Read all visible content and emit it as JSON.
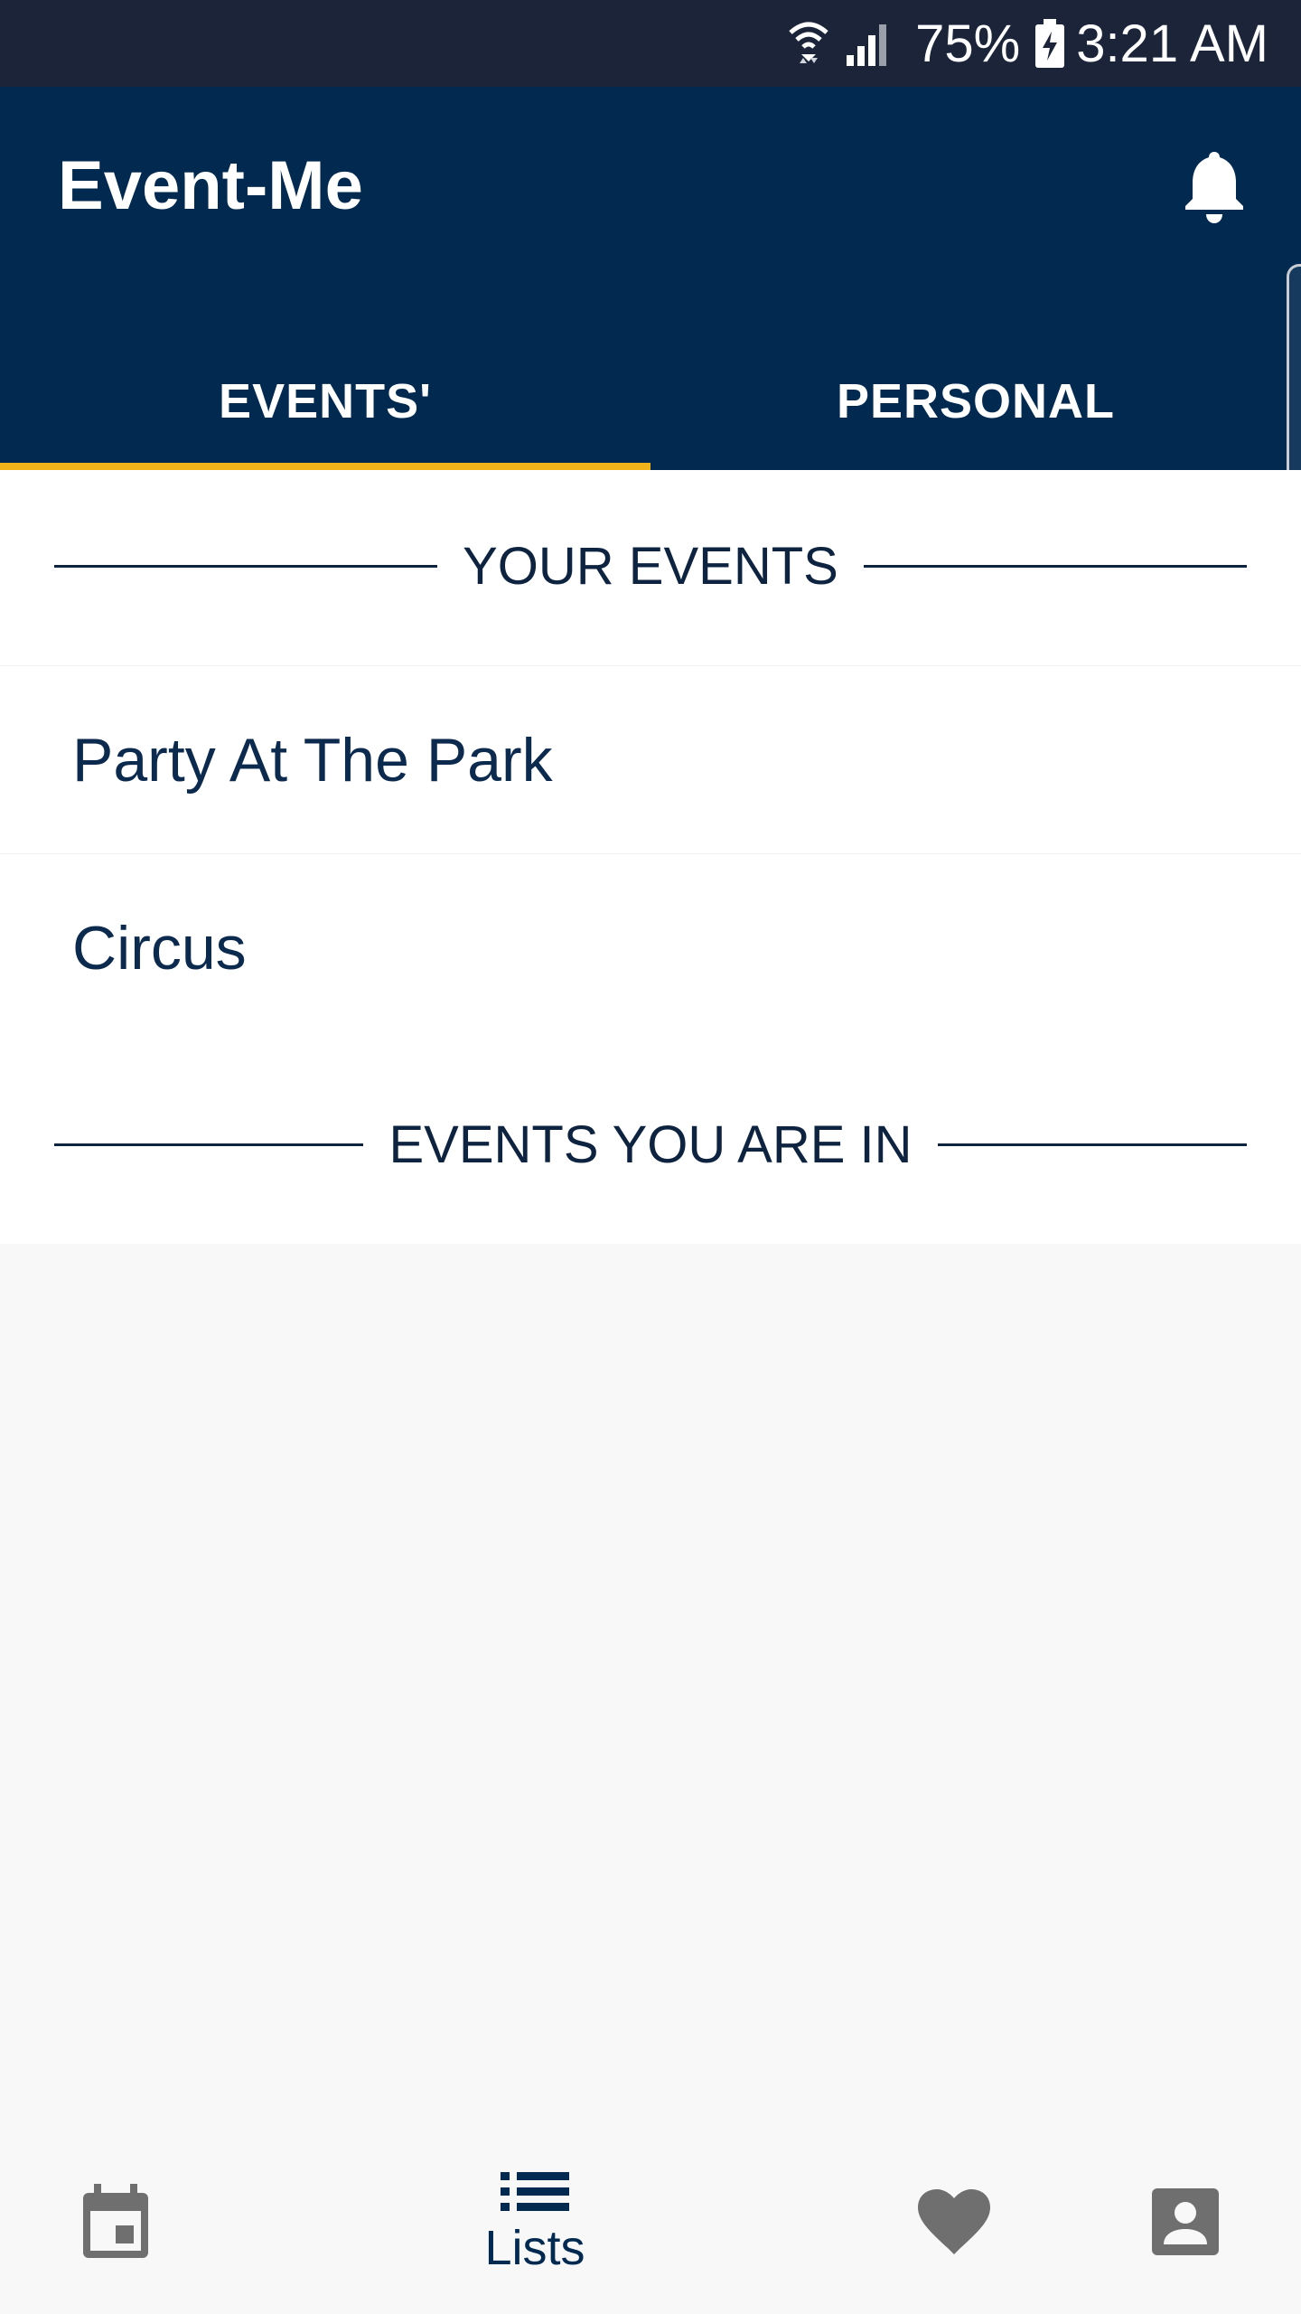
{
  "status_bar": {
    "battery_percent": "75%",
    "time": "3:21 AM",
    "icons": [
      "wifi-icon",
      "cell-signal-icon",
      "battery-charging-icon"
    ]
  },
  "app_bar": {
    "title": "Event-Me",
    "notification_icon": "bell-icon"
  },
  "tabs": [
    {
      "label": "EVENTS'",
      "selected": true
    },
    {
      "label": "PERSONAL",
      "selected": false
    }
  ],
  "your_events": {
    "header": "YOUR EVENTS",
    "items": [
      {
        "label": "Party At The Park"
      },
      {
        "label": "Circus"
      }
    ]
  },
  "events_you_are_in": {
    "header": "EVENTS YOU ARE IN",
    "items": []
  },
  "bottom_nav": {
    "items": [
      {
        "icon": "calendar-icon",
        "label": ""
      },
      {
        "icon": "list-icon",
        "label": "Lists",
        "selected": true
      },
      {
        "icon": "heart-icon",
        "label": ""
      },
      {
        "icon": "profile-icon",
        "label": ""
      }
    ]
  },
  "colors": {
    "status_bar": "#1b2439",
    "primary": "#022a51",
    "tab_indicator": "#f2b21a",
    "inactive_icon": "#6f6f6f",
    "background": "#f8f8f8"
  }
}
